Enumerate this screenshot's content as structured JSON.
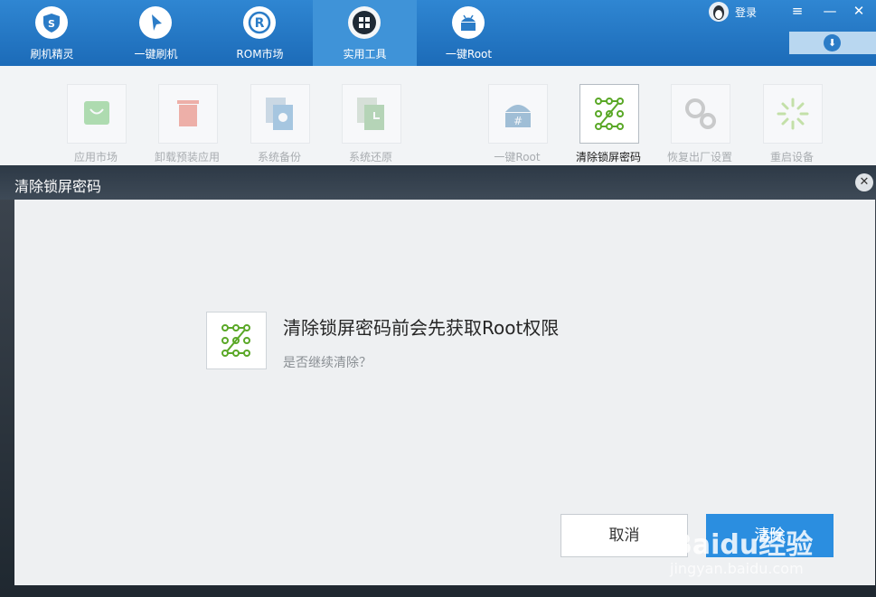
{
  "nav": {
    "tabs": [
      {
        "label": "刷机精灵",
        "icon": "shield-icon"
      },
      {
        "label": "一键刷机",
        "icon": "cursor-icon"
      },
      {
        "label": "ROM市场",
        "icon": "rom-r-icon"
      },
      {
        "label": "实用工具",
        "icon": "grid-icon",
        "active": true
      },
      {
        "label": "一键Root",
        "icon": "android-root-icon"
      }
    ],
    "login_label": "登录"
  },
  "toolbar": {
    "tools": [
      {
        "label": "应用市场",
        "icon": "shopping-bag-icon"
      },
      {
        "label": "卸载预装应用",
        "icon": "trash-icon"
      },
      {
        "label": "系统备份",
        "icon": "backup-icon"
      },
      {
        "label": "系统还原",
        "icon": "restore-clock-icon"
      },
      {
        "label": "一键Root",
        "icon": "android-root-icon"
      },
      {
        "label": "清除锁屏密码",
        "icon": "pattern-lock-icon",
        "selected": true
      },
      {
        "label": "恢复出厂设置",
        "icon": "gears-icon"
      },
      {
        "label": "重启设备",
        "icon": "loading-spinner-icon"
      }
    ]
  },
  "dialog": {
    "title": "清除锁屏密码",
    "message": "清除锁屏密码前会先获取Root权限",
    "question": "是否继续清除？",
    "cancel_label": "取消",
    "confirm_label": "清除"
  },
  "watermark": {
    "text": "Baidu经验",
    "url": "jingyan.baidu.com"
  },
  "colors": {
    "brand_blue": "#1c6bb8",
    "pattern_green": "#5aa827",
    "confirm_blue": "#2b8ee0"
  }
}
